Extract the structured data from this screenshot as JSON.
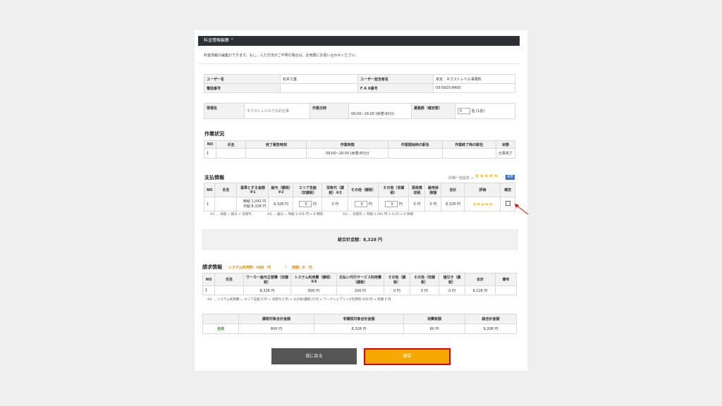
{
  "header": {
    "title": "料金情報編集 ^"
  },
  "description": "料金情報の編集ができます。もし、入力方法がご不明な場合は、お気軽にお問い合わせください。",
  "user_info": {
    "user_name_label": "ユーザー名",
    "user_name": "石井工業",
    "contact_label": "ユーザー担当者名",
    "contact": "未定　ネクストレベル事務所",
    "phone_label": "電話番号",
    "phone": "",
    "fax_label": "F A X番号",
    "fax": "03-5925-8400"
  },
  "site_info": {
    "site_label": "現場名",
    "site": "ネクストレベルでのお仕事",
    "date_label": "作業日時",
    "date": "09:00~18:00 (休憩:60分)",
    "count_label": "募集数（確定数）",
    "count": "5",
    "count_unit": "名 (1名)"
  },
  "work_status": {
    "title": "作業状況",
    "headers": [
      "NO",
      "氏名",
      "完了報告時刻",
      "作業時間",
      "作業開始時の駅名",
      "作業終了時の駅名",
      "状態"
    ],
    "row": {
      "no": "1",
      "name": "",
      "reported": "",
      "time": "09:00~18:00 (休憩:60分)",
      "start": "",
      "end": "",
      "status": "仕事完了"
    }
  },
  "payment": {
    "title": "支払情報",
    "bulk_label": "評価一括設定 ⇒",
    "apply_label": "適用",
    "headers": [
      "NO",
      "氏名",
      "基準とする金額※1",
      "給与（課税）※2",
      "エリア支給（非課税）",
      "深夜代（課税）※3",
      "その他（課税）",
      "その他（非課税）",
      "源泉徴収税",
      "雇用保険額",
      "合計",
      "評価",
      "確定"
    ],
    "row": {
      "no": "1",
      "name": "",
      "base_line1": "時給 1,041 円",
      "base_line2": "日給 8,328 円",
      "salary": "8,328 円",
      "area": "0",
      "area_unit": "円",
      "night": "0 円",
      "other_tax": "0",
      "other_tax_unit": "円",
      "other_notax": "0",
      "other_notax_unit": "円",
      "withholding": "0 円",
      "insurance": "0 円",
      "total": "8,328 円"
    },
    "notes": [
      "※1 … 日給 = 給与 + 深夜代",
      "※2 … 給与 = 時給 1,041 円 × 8 時間",
      "※3 … 深夜代 = 時給 1,041 円 × 0.25 × 0 時間"
    ]
  },
  "grand_total": "総合計金額：8,328 円",
  "billing": {
    "title": "請求情報",
    "system_fee": "システム利用料：600　円",
    "separator": "|",
    "sag": "捺額：0　円",
    "headers": [
      "NO",
      "氏名",
      "ワーカー給与立替費（非課税）",
      "システム利用費（課税）※4",
      "日払い代行サービス利用費（課税）",
      "その他（課税）",
      "その他（非課税）",
      "値引き（課税）",
      "合計",
      "備考"
    ],
    "row": {
      "no": "1",
      "name": "",
      "worker": "8,328 円",
      "system": "600 円",
      "daily": "200 円",
      "other_tax": "0 円",
      "other_notax": "0 円",
      "discount": "0 円",
      "total": "9,128 円",
      "remark": ""
    },
    "note": "※4 … システム利用費 = エリア支給 0 円 + 深夜代 0 円 + その他(課税) 0 円 + ワークシェアリング利用料 600 円 + 捺額 0 円"
  },
  "summary": {
    "headers": [
      "",
      "課税対象合計金額",
      "非課税対象合計金額",
      "消費税額",
      "総合計金額"
    ],
    "row": {
      "label": "全体",
      "taxable": "800 円",
      "nontaxable": "8,328 円",
      "tax": "80 円",
      "total": "9,208 円"
    }
  },
  "buttons": {
    "back": "前に戻る",
    "confirm": "確認"
  },
  "colors": {
    "header_bg": "#2b2f36",
    "confirm_bg": "#f5a800",
    "confirm_border": "#e00000",
    "back_bg": "#555555",
    "star": "#f2c230"
  }
}
